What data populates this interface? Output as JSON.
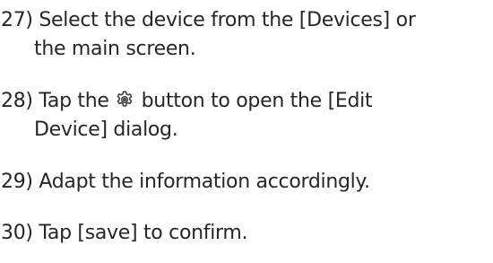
{
  "steps": [
    {
      "number": "27)",
      "lines": [
        "Select the device from the [Devices] or",
        "the main screen."
      ]
    },
    {
      "number": "28)",
      "line1_before": "Tap the",
      "icon": "gear-icon",
      "line1_after": "button to open the [Edit",
      "line2": "Device] dialog."
    },
    {
      "number": "29)",
      "text": "Adapt the information accordingly."
    },
    {
      "number": "30)",
      "text": "Tap [save] to confirm."
    }
  ]
}
